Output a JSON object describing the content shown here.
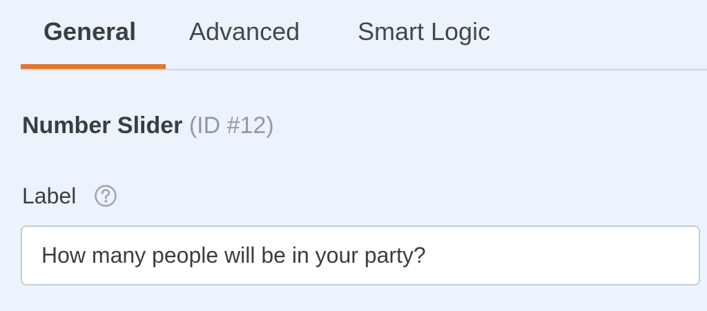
{
  "tabs": [
    {
      "label": "General",
      "active": true
    },
    {
      "label": "Advanced",
      "active": false
    },
    {
      "label": "Smart Logic",
      "active": false
    }
  ],
  "field": {
    "name": "Number Slider",
    "id_text": "(ID #12)"
  },
  "label_field": {
    "label": "Label",
    "help_icon": "question-circle-icon",
    "value": "How many people will be in your party?"
  },
  "colors": {
    "background": "#ebf3fc",
    "active_tab_underline": "#e27730",
    "text": "#3b3d40",
    "muted": "#8e9aa8"
  }
}
